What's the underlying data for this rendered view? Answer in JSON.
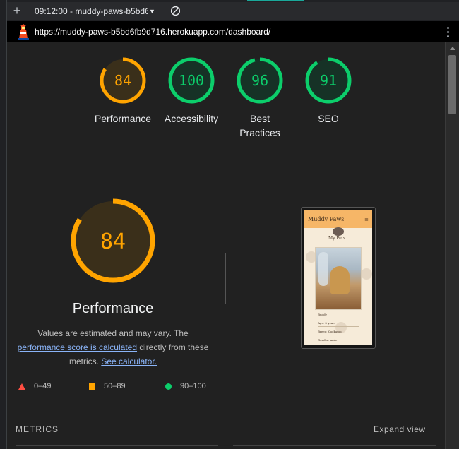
{
  "toolbar": {
    "add_label": "+",
    "report_label": "09:12:00 - muddy-paws-b5bd6",
    "caret": "▼"
  },
  "urlbar": {
    "url": "https://muddy-paws-b5bd6fb9d716.herokuapp.com/dashboard/"
  },
  "summary": {
    "gauges": [
      {
        "label": "Performance",
        "score": "84",
        "value": 0.84,
        "color": "#ffa400",
        "bg": "#3a2f1a"
      },
      {
        "label": "Accessibility",
        "score": "100",
        "value": 1.0,
        "color": "#0cce6b",
        "bg": "#163226"
      },
      {
        "label": "Best Practices",
        "score": "96",
        "value": 0.96,
        "color": "#0cce6b",
        "bg": "#163226"
      },
      {
        "label": "SEO",
        "score": "91",
        "value": 0.91,
        "color": "#0cce6b",
        "bg": "#163226"
      }
    ]
  },
  "performance": {
    "score": "84",
    "value": 0.84,
    "title": "Performance",
    "desc_1": "Values are estimated and may vary. The",
    "desc_link_1": "performance score is calculated",
    "desc_2": " directly from these metrics. ",
    "desc_link_2": "See calculator."
  },
  "legend": [
    {
      "range": "0–49",
      "color": "#ff4e42"
    },
    {
      "range": "50–89",
      "color": "#ffa400"
    },
    {
      "range": "90–100",
      "color": "#0cce6b"
    }
  ],
  "screenshot": {
    "brand": "Muddy Paws",
    "menu_glyph": "≡",
    "page_title": "My Pets",
    "lines": [
      "Buddy",
      "Age: 5 years",
      "Breed: Cockapoo",
      "Gender: male"
    ]
  },
  "metrics": {
    "heading": "METRICS",
    "expand_label": "Expand view"
  }
}
